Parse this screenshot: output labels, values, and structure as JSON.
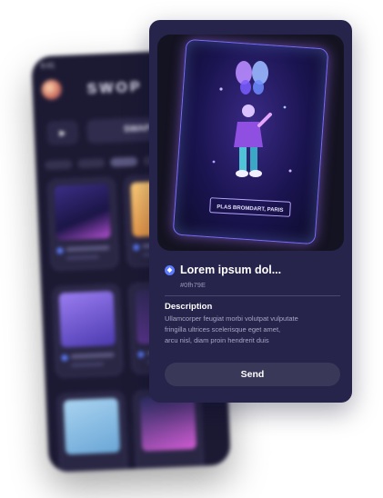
{
  "background_app": {
    "status_time": "9:41",
    "brand": "SWOP",
    "button_label": "SWAP"
  },
  "nft": {
    "art_caption": "PLAS BROMDART, PARIS",
    "title": "Lorem ipsum dol...",
    "token_id": "#0fh79E"
  },
  "description": {
    "heading": "Description",
    "body_lines": [
      "Ullamcorper feugiat morbi volutpat vulputate",
      "fringilla ultrices scelerisque eget amet,",
      "arcu nisl, diam proin hendrerit duis"
    ]
  },
  "actions": {
    "send_label": "Send"
  },
  "colors": {
    "card_bg": "#26244a",
    "accent": "#5d7bff",
    "button_bg": "#3a3858"
  }
}
